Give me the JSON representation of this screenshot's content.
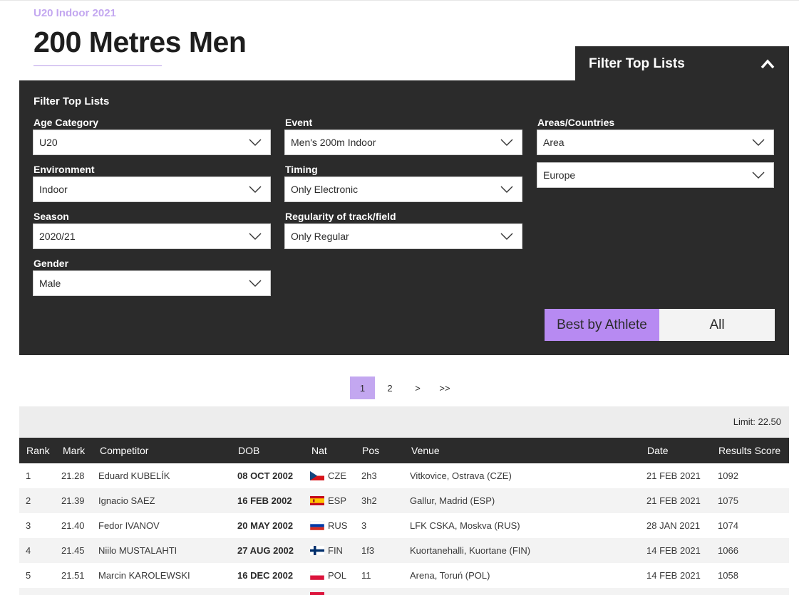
{
  "page": {
    "subtitle": "U20 Indoor 2021",
    "title": "200 Metres Men"
  },
  "filter_tab": {
    "label": "Filter Top Lists",
    "icon": "chevron-up-icon"
  },
  "filters": {
    "panel_title": "Filter Top Lists",
    "age_category": {
      "label": "Age Category",
      "value": "U20"
    },
    "environment": {
      "label": "Environment",
      "value": "Indoor"
    },
    "season": {
      "label": "Season",
      "value": "2020/21"
    },
    "gender": {
      "label": "Gender",
      "value": "Male"
    },
    "event": {
      "label": "Event",
      "value": "Men's 200m Indoor"
    },
    "timing": {
      "label": "Timing",
      "value": "Only Electronic"
    },
    "regularity": {
      "label": "Regularity of track/field",
      "value": "Only Regular"
    },
    "areas": {
      "label": "Areas/Countries",
      "value": "Area"
    },
    "region": {
      "value": "Europe"
    },
    "toggle": {
      "best": "Best by Athlete",
      "all": "All",
      "selected": "Best by Athlete"
    }
  },
  "pagination": {
    "pages": [
      "1",
      "2"
    ],
    "current": "1",
    "next": ">",
    "last": ">>"
  },
  "limit": "Limit: 22.50",
  "table": {
    "headers": {
      "rank": "Rank",
      "mark": "Mark",
      "competitor": "Competitor",
      "dob": "DOB",
      "nat": "Nat",
      "pos": "Pos",
      "venue": "Venue",
      "date": "Date",
      "score": "Results Score"
    },
    "rows": [
      {
        "rank": "1",
        "mark": "21.28",
        "competitor": "Eduard KUBELÍK",
        "dob": "08 OCT 2002",
        "nat": "CZE",
        "pos": "2h3",
        "venue": "Vitkovice, Ostrava (CZE)",
        "date": "21 FEB 2021",
        "score": "1092"
      },
      {
        "rank": "2",
        "mark": "21.39",
        "competitor": "Ignacio SAEZ",
        "dob": "16 FEB 2002",
        "nat": "ESP",
        "pos": "3h2",
        "venue": "Gallur, Madrid (ESP)",
        "date": "21 FEB 2021",
        "score": "1075"
      },
      {
        "rank": "3",
        "mark": "21.40",
        "competitor": "Fedor IVANOV",
        "dob": "20 MAY 2002",
        "nat": "RUS",
        "pos": "3",
        "venue": "LFK CSKA, Moskva (RUS)",
        "date": "28 JAN 2021",
        "score": "1074"
      },
      {
        "rank": "4",
        "mark": "21.45",
        "competitor": "Niilo MUSTALAHTI",
        "dob": "27 AUG 2002",
        "nat": "FIN",
        "pos": "1f3",
        "venue": "Kuortanehalli, Kuortane (FIN)",
        "date": "14 FEB 2021",
        "score": "1066"
      },
      {
        "rank": "5",
        "mark": "21.51",
        "competitor": "Marcin KAROLEWSKI",
        "dob": "16 DEC 2002",
        "nat": "POL",
        "pos": "11",
        "venue": "Arena, Toruń (POL)",
        "date": "14 FEB 2021",
        "score": "1058"
      }
    ]
  },
  "colors": {
    "accent": "#b78af2",
    "dark_panel": "#2b2b2b",
    "subtitle": "#c3a7f0"
  }
}
